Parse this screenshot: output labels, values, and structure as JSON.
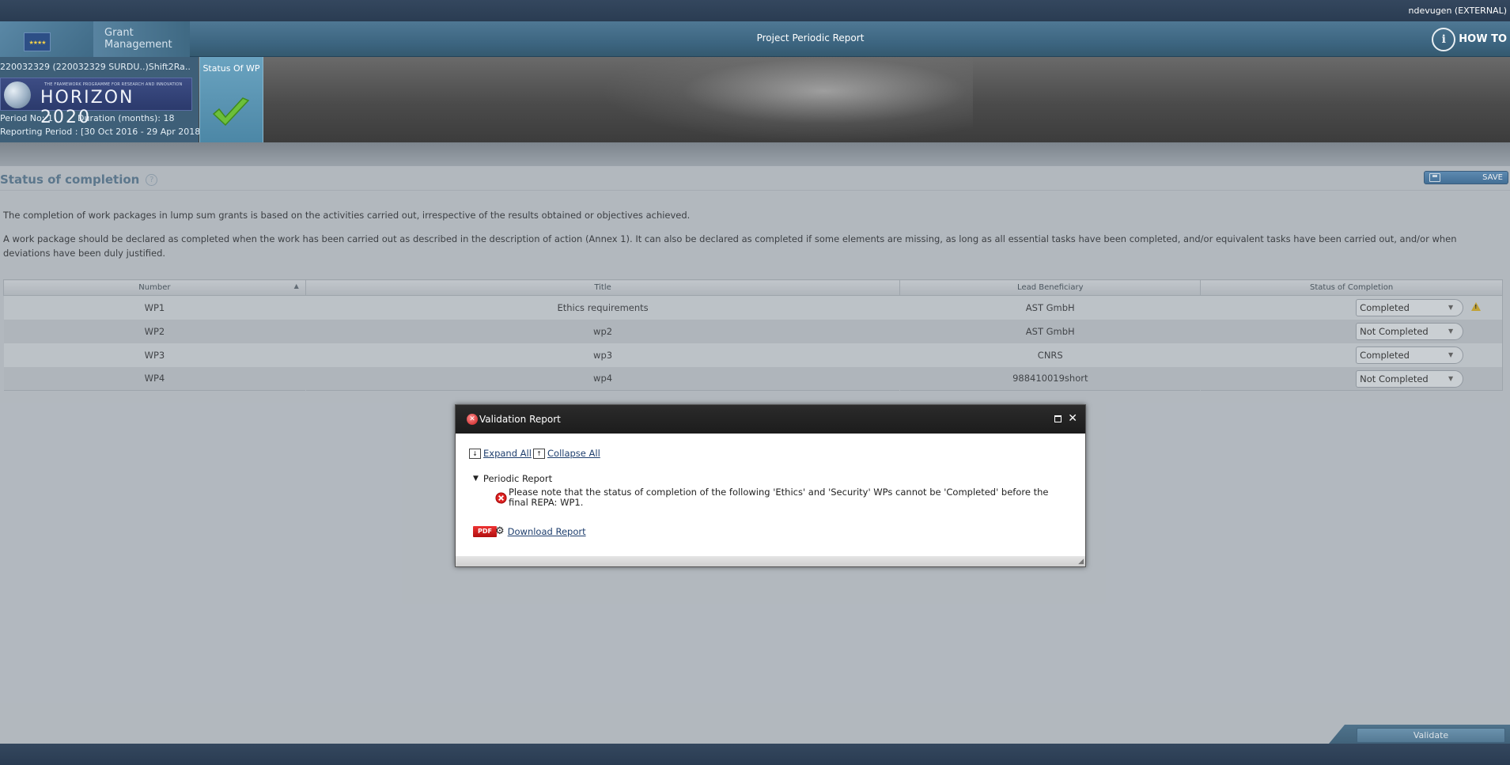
{
  "user": {
    "name": "ndevugen (EXTERNAL)"
  },
  "header": {
    "org_line1": "Grant",
    "org_line2": "Management",
    "title": "Project Periodic Report",
    "howto_label": "HOW TO"
  },
  "project": {
    "id_text": "220032329 (220032329 SURDU..)Shift2Ra..",
    "programme_tagline": "THE FRAMEWORK PROGRAMME FOR RESEARCH AND INNOVATION",
    "programme_name": "HORIZON 2020",
    "period_no": "Period No: 1",
    "duration": "Duration (months): 18",
    "reporting_period": "Reporting Period : [30 Oct 2016 - 29 Apr 2018]"
  },
  "status_wp": {
    "label": "Status Of WP"
  },
  "section": {
    "title": "Status of completion",
    "save_label": "SAVE",
    "paragraph1": "The completion of work packages in lump sum grants is based on the activities carried out, irrespective of the results obtained or objectives achieved.",
    "paragraph2": "A work package should be declared as completed when the work has been carried out as described in the description of action (Annex 1). It can also be declared as completed if some elements are missing, as long as all essential tasks have been completed, and/or equivalent tasks have been carried out, and/or when deviations have been duly justified."
  },
  "table": {
    "headers": [
      "Number",
      "Title",
      "Lead Beneficiary",
      "Status of Completion"
    ],
    "rows": [
      {
        "number": "WP1",
        "title": "Ethics requirements",
        "lead": "AST GmbH",
        "status": "Completed"
      },
      {
        "number": "WP2",
        "title": "wp2",
        "lead": "AST GmbH",
        "status": "Not Completed"
      },
      {
        "number": "WP3",
        "title": "wp3",
        "lead": "CNRS",
        "status": "Completed"
      },
      {
        "number": "WP4",
        "title": "wp4",
        "lead": "988410019short",
        "status": "Not Completed"
      }
    ]
  },
  "dialog": {
    "title": "Validation Report",
    "expand_all": "Expand All",
    "collapse_all": "Collapse All",
    "node_label": "Periodic Report",
    "message": "Please note that the status of completion of the following 'Ethics' and 'Security' WPs cannot be 'Completed' before the final REPA: WP1.",
    "pdf_badge": "PDF",
    "download_label": "Download Report"
  },
  "footer": {
    "validate_label": "Validate"
  },
  "colors": {
    "header_blue": "#3d6681",
    "error_red": "#c81e1e",
    "warning_yellow": "#c9a21a",
    "link_blue": "#1f3f6e"
  }
}
